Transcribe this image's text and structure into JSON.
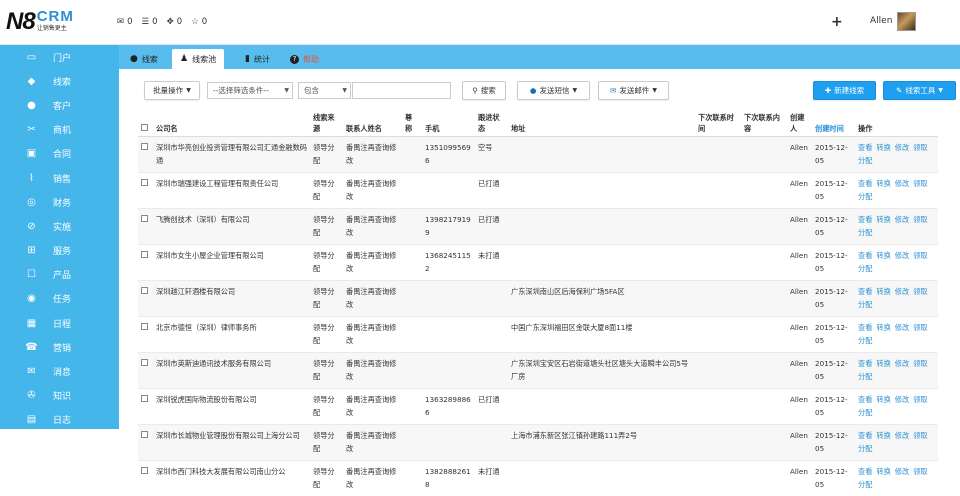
{
  "logo": {
    "n8": "N8",
    "crm": "CRM",
    "tagline": "让销售更主"
  },
  "topbar": {
    "mail_count": "0",
    "task_count": "0",
    "share_count": "0",
    "star_count": "0",
    "add": "+",
    "user_name": "Allen"
  },
  "sidebar": {
    "items": [
      {
        "label": "门户",
        "icon": "monitor-icon",
        "glyph": "▭"
      },
      {
        "label": "线索",
        "icon": "document-icon",
        "glyph": "◆"
      },
      {
        "label": "客户",
        "icon": "user-icon",
        "glyph": "●"
      },
      {
        "label": "商机",
        "icon": "scissors-icon",
        "glyph": "✂"
      },
      {
        "label": "合同",
        "icon": "clipboard-icon",
        "glyph": "▣"
      },
      {
        "label": "销售",
        "icon": "chart-icon",
        "glyph": "⌇"
      },
      {
        "label": "财务",
        "icon": "money-icon",
        "glyph": "◎"
      },
      {
        "label": "实施",
        "icon": "compass-icon",
        "glyph": "⊘"
      },
      {
        "label": "服务",
        "icon": "service-icon",
        "glyph": "⊞"
      },
      {
        "label": "产品",
        "icon": "box-icon",
        "glyph": "☐"
      },
      {
        "label": "任务",
        "icon": "target-icon",
        "glyph": "◉"
      },
      {
        "label": "日程",
        "icon": "calendar-icon",
        "glyph": "▦"
      },
      {
        "label": "营销",
        "icon": "phone-icon",
        "glyph": "☎"
      },
      {
        "label": "消息",
        "icon": "envelope-icon",
        "glyph": "✉"
      },
      {
        "label": "知识",
        "icon": "book-icon",
        "glyph": "✇"
      },
      {
        "label": "日志",
        "icon": "log-icon",
        "glyph": "▤"
      }
    ]
  },
  "tabs": [
    {
      "label": "线索",
      "glyph": "💡"
    },
    {
      "label": "线索池",
      "glyph": "👥"
    },
    {
      "label": "统计",
      "glyph": "▮"
    },
    {
      "label": "帮助",
      "glyph": "?"
    }
  ],
  "toolbar": {
    "batch": "批量操作",
    "filter_placeholder": "--选择筛选条件--",
    "match": "包含",
    "search": "搜索",
    "sms": "发送短信",
    "email": "发送邮件",
    "new": "新建线索",
    "tools": "线索工具"
  },
  "table": {
    "columns": [
      "公司名",
      "线索来源",
      "联系人姓名",
      "尊称",
      "手机",
      "跟进状态",
      "地址",
      "下次联系时间",
      "下次联系内容",
      "创建人",
      "创建时间",
      "操作"
    ],
    "actions": [
      "查看",
      "转换",
      "修改",
      "领取",
      "分配"
    ],
    "rows": [
      {
        "company": "深圳市华亮创业投资管理有限公司汇通金融数码通",
        "source": "领导分配",
        "contact": "番禺注再查询修改",
        "title": "",
        "mobile": "13510995696",
        "status": "空号",
        "address": "",
        "creator": "Allen",
        "created": "2015-12-05"
      },
      {
        "company": "深圳市瑞强建设工程管理有限责任公司",
        "source": "领导分配",
        "contact": "番禺注再查询修改",
        "title": "",
        "mobile": "",
        "status": "已打通",
        "address": "",
        "creator": "Allen",
        "created": "2015-12-05"
      },
      {
        "company": "飞腾创技术（深圳）有限公司",
        "source": "领导分配",
        "contact": "番禺注再查询修改",
        "title": "",
        "mobile": "13982179199",
        "status": "已打通",
        "address": "",
        "creator": "Allen",
        "created": "2015-12-05"
      },
      {
        "company": "深圳市女生小屋企业管理有限公司",
        "source": "领导分配",
        "contact": "番禺注再查询修改",
        "title": "",
        "mobile": "13682451152",
        "status": "未打通",
        "address": "",
        "creator": "Allen",
        "created": "2015-12-05"
      },
      {
        "company": "深圳越江轩酒楼有限公司",
        "source": "领导分配",
        "contact": "番禺注再查询修改",
        "title": "",
        "mobile": "",
        "status": "",
        "address": "广东深圳南山区后海保利广场5FA区",
        "creator": "Allen",
        "created": "2015-12-05"
      },
      {
        "company": "北京市德恒（深圳）律师事务所",
        "source": "领导分配",
        "contact": "番禺注再查询修改",
        "title": "",
        "mobile": "",
        "status": "",
        "address": "中国广东深圳福田区金联大厦8面11楼",
        "creator": "Allen",
        "created": "2015-12-05"
      },
      {
        "company": "深圳市英斯迪通讯技术服务有限公司",
        "source": "领导分配",
        "contact": "番禺注再查询修改",
        "title": "",
        "mobile": "",
        "status": "",
        "address": "广东深圳宝安区石岩街道塘头社区塘头大道瞬丰公司5号厂房",
        "creator": "Allen",
        "created": "2015-12-05"
      },
      {
        "company": "深圳锐虎国际物流股份有限公司",
        "source": "领导分配",
        "contact": "番禺注再查询修改",
        "title": "",
        "mobile": "13632898866",
        "status": "已打通",
        "address": "",
        "creator": "Allen",
        "created": "2015-12-05"
      },
      {
        "company": "深圳市长城物业管理股份有限公司上海分公司",
        "source": "领导分配",
        "contact": "番禺注再查询修改",
        "title": "",
        "mobile": "",
        "status": "",
        "address": "上海市浦东新区张江镇孙建路111弄2号",
        "creator": "Allen",
        "created": "2015-12-05"
      },
      {
        "company": "深圳市西门科技大发展有限公司南山分公",
        "source": "领导分配",
        "contact": "番禺注再查询修改",
        "title": "",
        "mobile": "13828882618",
        "status": "未打通",
        "address": "",
        "creator": "Allen",
        "created": "2015-12-05"
      }
    ]
  }
}
